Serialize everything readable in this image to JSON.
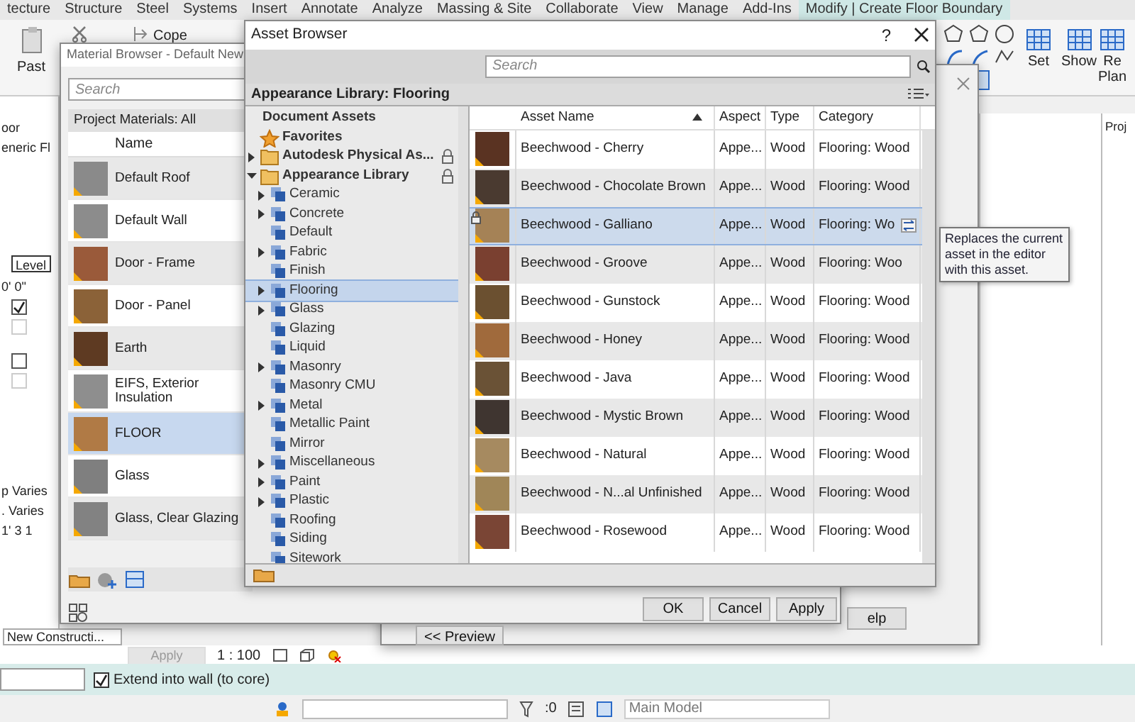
{
  "ribbon_tabs": [
    {
      "label": "tecture",
      "selected": false
    },
    {
      "label": "Structure",
      "selected": false
    },
    {
      "label": "Steel",
      "selected": false
    },
    {
      "label": "Systems",
      "selected": false
    },
    {
      "label": "Insert",
      "selected": false
    },
    {
      "label": "Annotate",
      "selected": false
    },
    {
      "label": "Analyze",
      "selected": false
    },
    {
      "label": "Massing & Site",
      "selected": false
    },
    {
      "label": "Collaborate",
      "selected": false
    },
    {
      "label": "View",
      "selected": false
    },
    {
      "label": "Manage",
      "selected": false
    },
    {
      "label": "Add-Ins",
      "selected": false
    },
    {
      "label": "Modify | Create Floor Boundary",
      "selected": true
    }
  ],
  "ribbon_left": {
    "paste": "Past",
    "cope": "Cope"
  },
  "ribbon_right": [
    {
      "lines": [
        "Set"
      ]
    },
    {
      "lines": [
        "Show"
      ]
    },
    {
      "lines": [
        "Re",
        "Plan"
      ]
    }
  ],
  "properties_panel": {
    "items": [
      {
        "kind": "text",
        "text": "oor"
      },
      {
        "kind": "text",
        "text": "eneric Fl"
      },
      {
        "kind": "header",
        "text": "Level"
      },
      {
        "kind": "text",
        "text": "0'  0\""
      },
      {
        "kind": "checkbox",
        "checked": true,
        "disabled": false
      },
      {
        "kind": "checkbox",
        "checked": false,
        "disabled": true
      },
      {
        "kind": "checkbox",
        "checked": false,
        "disabled": false
      },
      {
        "kind": "checkbox",
        "checked": false,
        "disabled": true
      },
      {
        "kind": "text",
        "text": "p Varies"
      },
      {
        "kind": "text",
        "text": ". Varies"
      },
      {
        "kind": "text",
        "text": "1'  3 1"
      }
    ],
    "phase": "New Constructi...",
    "apply": "Apply"
  },
  "project_browser": {
    "title": "Proj"
  },
  "view_bar": {
    "scale": "1 : 100"
  },
  "options_bar": {
    "checkbox": {
      "label": "Extend into wall (to core)",
      "checked": true
    }
  },
  "status_bar": {
    "count": ":0",
    "model": "Main Model"
  },
  "material_editor": {
    "help": "elp",
    "preview": "<< Preview"
  },
  "material_browser": {
    "title": "Material Browser - Default New",
    "search_placeholder": "Search",
    "filter": "Project Materials: All",
    "column": "Name",
    "rows": [
      {
        "name": "Default Roof",
        "color": "#8a8a8a",
        "selected": false
      },
      {
        "name": "Default Wall",
        "color": "#8c8c8c",
        "selected": false
      },
      {
        "name": "Door - Frame",
        "color": "#9a5a3a",
        "selected": false
      },
      {
        "name": "Door - Panel",
        "color": "#8b6238",
        "selected": false
      },
      {
        "name": "Earth",
        "color": "#5e3a22",
        "selected": false
      },
      {
        "name": "EIFS, Exterior Insulation",
        "color": "#8e8e8e",
        "selected": false
      },
      {
        "name": "FLOOR",
        "color": "#b07a45",
        "selected": true
      },
      {
        "name": "Glass",
        "color": "#7f7f7f",
        "selected": false
      },
      {
        "name": "Glass, Clear Glazing",
        "color": "#828282",
        "selected": false
      }
    ],
    "buttons": [
      "OK",
      "Cancel",
      "Apply"
    ]
  },
  "asset_browser": {
    "title": "Asset Browser",
    "help": "?",
    "search_placeholder": "Search",
    "header": "Appearance Library: Flooring",
    "tree": [
      {
        "label": "Document Assets",
        "kind": "heading",
        "locked": false,
        "selected": false
      },
      {
        "label": "Favorites",
        "kind": "favorites",
        "locked": false,
        "selected": false
      },
      {
        "label": "Autodesk Physical As...",
        "kind": "folder",
        "expanded": false,
        "locked": true,
        "selected": false
      },
      {
        "label": "Appearance Library",
        "kind": "folder",
        "expanded": true,
        "locked": true,
        "selected": false,
        "children": [
          {
            "label": "Ceramic",
            "kind": "category",
            "expanded": false,
            "selected": false
          },
          {
            "label": "Concrete",
            "kind": "category",
            "expanded": false,
            "selected": false
          },
          {
            "label": "Default",
            "kind": "category",
            "selected": false
          },
          {
            "label": "Fabric",
            "kind": "category",
            "expanded": false,
            "selected": false
          },
          {
            "label": "Finish",
            "kind": "category",
            "selected": false
          },
          {
            "label": "Flooring",
            "kind": "category",
            "expanded": false,
            "selected": true
          },
          {
            "label": "Glass",
            "kind": "category",
            "expanded": false,
            "selected": false
          },
          {
            "label": "Glazing",
            "kind": "category",
            "selected": false
          },
          {
            "label": "Liquid",
            "kind": "category",
            "selected": false
          },
          {
            "label": "Masonry",
            "kind": "category",
            "expanded": false,
            "selected": false
          },
          {
            "label": "Masonry CMU",
            "kind": "category",
            "selected": false
          },
          {
            "label": "Metal",
            "kind": "category",
            "expanded": false,
            "selected": false
          },
          {
            "label": "Metallic Paint",
            "kind": "category",
            "selected": false
          },
          {
            "label": "Mirror",
            "kind": "category",
            "selected": false
          },
          {
            "label": "Miscellaneous",
            "kind": "category",
            "expanded": false,
            "selected": false
          },
          {
            "label": "Paint",
            "kind": "category",
            "expanded": false,
            "selected": false
          },
          {
            "label": "Plastic",
            "kind": "category",
            "expanded": false,
            "selected": false
          },
          {
            "label": "Roofing",
            "kind": "category",
            "selected": false
          },
          {
            "label": "Siding",
            "kind": "category",
            "selected": false
          },
          {
            "label": "Sitework",
            "kind": "category",
            "selected": false
          }
        ]
      }
    ],
    "columns": [
      "Asset Name",
      "Aspect",
      "Type",
      "Category"
    ],
    "rows": [
      {
        "name": "Beechwood - Cherry",
        "aspect": "Appe...",
        "type": "Wood",
        "category": "Flooring: Wood",
        "color": "#5a3322",
        "selected": false,
        "locked": false
      },
      {
        "name": "Beechwood - Chocolate Brown",
        "aspect": "Appe...",
        "type": "Wood",
        "category": "Flooring: Wood",
        "color": "#4a3a30",
        "selected": false,
        "locked": false
      },
      {
        "name": "Beechwood - Galliano",
        "aspect": "Appe...",
        "type": "Wood",
        "category": "Flooring: Wo",
        "color": "#a58256",
        "selected": true,
        "locked": true
      },
      {
        "name": "Beechwood - Groove",
        "aspect": "Appe...",
        "type": "Wood",
        "category": "Flooring: Woo",
        "color": "#7a4030",
        "selected": false,
        "locked": false
      },
      {
        "name": "Beechwood - Gunstock",
        "aspect": "Appe...",
        "type": "Wood",
        "category": "Flooring: Wood",
        "color": "#6b5030",
        "selected": false,
        "locked": false
      },
      {
        "name": "Beechwood - Honey",
        "aspect": "Appe...",
        "type": "Wood",
        "category": "Flooring: Wood",
        "color": "#a06a3c",
        "selected": false,
        "locked": false
      },
      {
        "name": "Beechwood - Java",
        "aspect": "Appe...",
        "type": "Wood",
        "category": "Flooring: Wood",
        "color": "#6a5236",
        "selected": false,
        "locked": false
      },
      {
        "name": "Beechwood - Mystic Brown",
        "aspect": "Appe...",
        "type": "Wood",
        "category": "Flooring: Wood",
        "color": "#3f3530",
        "selected": false,
        "locked": false
      },
      {
        "name": "Beechwood - Natural",
        "aspect": "Appe...",
        "type": "Wood",
        "category": "Flooring: Wood",
        "color": "#a68a60",
        "selected": false,
        "locked": false
      },
      {
        "name": "Beechwood - N...al Unfinished",
        "aspect": "Appe...",
        "type": "Wood",
        "category": "Flooring: Wood",
        "color": "#a08658",
        "selected": false,
        "locked": false
      },
      {
        "name": "Beechwood - Rosewood",
        "aspect": "Appe...",
        "type": "Wood",
        "category": "Flooring: Wood",
        "color": "#7a4535",
        "selected": false,
        "locked": false
      }
    ]
  },
  "tooltip": "Replaces the current asset in the editor with this asset."
}
